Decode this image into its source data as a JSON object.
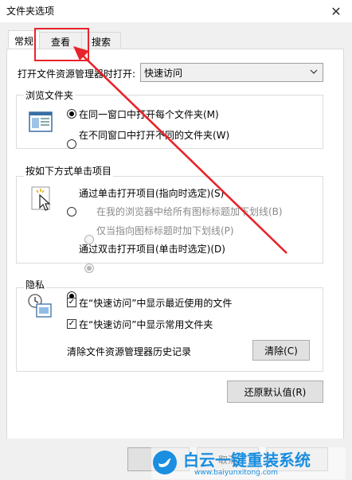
{
  "window": {
    "title": "文件夹选项"
  },
  "tabs": [
    {
      "label": "常规"
    },
    {
      "label": "查看"
    },
    {
      "label": "搜索"
    }
  ],
  "general": {
    "open_label": "打开文件资源管理器时打开:",
    "open_value": "快速访问",
    "browse": {
      "title": "浏览文件夹",
      "option_same": "在同一窗口中打开每个文件夹(M)",
      "option_new": "在不同窗口中打开不同的文件夹(W)"
    },
    "click": {
      "title": "按如下方式单击项目",
      "option_single": "通过单击打开项目(指向时选定)(S)",
      "option_browser_underline": "在我的浏览器中给所有图标标题加下划线(B)",
      "option_point_underline": "仅当指向图标标题时加下划线(P)",
      "option_double": "通过双击打开项目(单击时选定)(D)"
    },
    "privacy": {
      "title": "隐私",
      "check_recent": "在“快速访问”中显示最近使用的文件",
      "check_frequent": "在“快速访问”中显示常用文件夹",
      "clear_label": "清除文件资源管理器历史记录",
      "clear_button": "清除(C)"
    },
    "restore_button": "还原默认值(R)"
  },
  "footer": {
    "cancel_button": "取消"
  },
  "watermark": {
    "brand": "白云一键重装系统",
    "url": "www.baiyunxitong.com"
  },
  "colors": {
    "annotation_red": "#e8232a",
    "watermark_blue": "#1a8ee0"
  }
}
